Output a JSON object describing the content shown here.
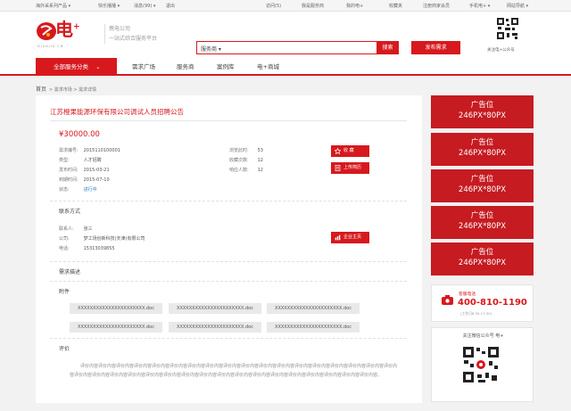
{
  "topbar": {
    "items": [
      "海外采系列产品 ▾",
      "快乐播播 ▾",
      "消息(99) ▾",
      "退出",
      "访问(5)",
      "我是服务商",
      "我的电+",
      "收藏夹",
      "注册商家会员",
      "手机电+ ▾",
      "网站导航 ▾"
    ]
  },
  "header": {
    "logo": "电",
    "logo_plus": "+",
    "logo_sub": "DIANJIA.CN",
    "tagline_line1": "携电公司",
    "tagline_line2": "一站式综合服务平台",
    "search_category": "服务商 ▾",
    "search_placeholder": "",
    "search_button": "搜索",
    "publish_button": "发布需求",
    "qr_label": "关注电+公众号"
  },
  "nav": {
    "all_label": "全部服务分类",
    "items": [
      "需求广场",
      "服务商",
      "案例库",
      "电+商城"
    ]
  },
  "breadcrumb": {
    "home": "首页",
    "path": "> 需求市场 > 需求详情"
  },
  "detail": {
    "title": "江苏橙果能源环保有限公司调试人员招聘公告",
    "price": "¥30000.00",
    "fields_left": [
      {
        "k": "需求编号:",
        "v": "2015110100001"
      },
      {
        "k": "类型:",
        "v": "人才招聘"
      },
      {
        "k": "发布时间:",
        "v": "2015-03-21"
      },
      {
        "k": "到期时间:",
        "v": "2015-07-10"
      },
      {
        "k": "状态:",
        "v": "进行中"
      }
    ],
    "fields_right": [
      {
        "k": "浏览此时:",
        "v": "53"
      },
      {
        "k": "收藏次数:",
        "v": "12"
      },
      {
        "k": "响应人数:",
        "v": "12"
      }
    ],
    "favorite_button": "收  藏",
    "upload_button": "上传简历",
    "contact_heading": "联系方式",
    "contact": [
      {
        "k": "联系人:",
        "v": "张三"
      },
      {
        "k": "公司:",
        "v": "梦工场创新科技(天津)有限公司"
      },
      {
        "k": "电话:",
        "v": "15313039855"
      }
    ],
    "homepage_button": "企业主页",
    "desc_heading": "需求描述",
    "attach_heading": "附件",
    "attachments": [
      "XXXXXXXXXXXXXXXXXXXXXX.doc",
      "XXXXXXXXXXXXXXXXXXXXXX.doc",
      "XXXXXXXXXXXXXXXXXXXXXX.doc",
      "XXXXXXXXXXXXXXXXXXXXXX.doc",
      "XXXXXXXXXXXXXXXXXXXXXX.doc",
      "XXXXXXXXXXXXXXXXXXXXXX.doc"
    ],
    "review_heading": "评价",
    "review_text": "评价内容评价内容评价内容评价内容评价内容评价内容评价内容评价内容评价内容评价内容评价内容评价内容评价内容评价内容评价内容评价内容评价内容评价内容评价内容评价内容评价内容评价内容评价内容评价内容评价内容评价内容评价内容评价内容评价内容评价内容评价内容评价内容评价内容评价内容评价内容。"
  },
  "sidebar": {
    "ads": [
      {
        "l1": "广告位",
        "l2": "246PX*80PX"
      },
      {
        "l1": "广告位",
        "l2": "246PX*80PX"
      },
      {
        "l1": "广告位",
        "l2": "246PX*80PX"
      },
      {
        "l1": "广告位",
        "l2": "246PX*80PX"
      },
      {
        "l1": "广告位",
        "l2": "246PX*80PX"
      }
    ],
    "hotline_label": "客服电话",
    "hotline_number": "400-810-1190",
    "hotline_hours": "(工作日8:30-17:30)",
    "follow_label": "关注微信公众号  电+"
  },
  "colors": {
    "accent": "#d7191e",
    "ad": "#c61b21"
  }
}
